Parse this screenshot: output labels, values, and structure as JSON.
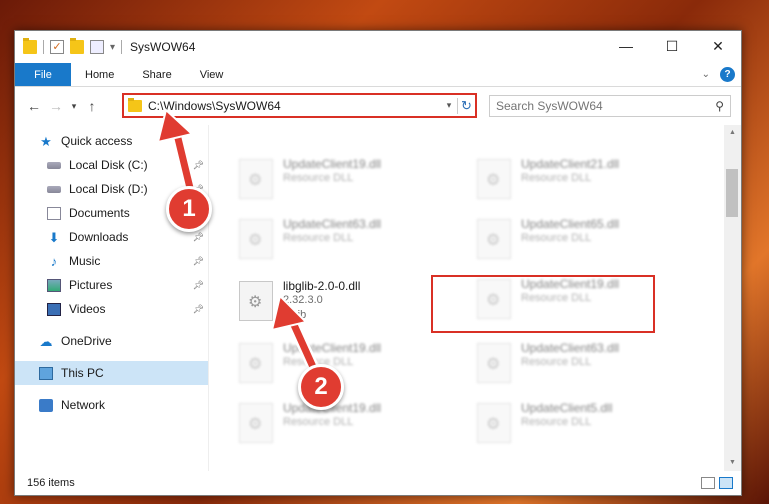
{
  "window": {
    "title": "SysWOW64",
    "controls": {
      "minimize": "—",
      "maximize": "☐",
      "close": "✕"
    }
  },
  "ribbon": {
    "tabs": [
      "File",
      "Home",
      "Share",
      "View"
    ]
  },
  "address": {
    "path": "C:\\Windows\\SysWOW64",
    "search_placeholder": "Search SysWOW64"
  },
  "sidebar": {
    "items": [
      {
        "label": "Quick access",
        "icon": "star-icon"
      },
      {
        "label": "Local Disk (C:)",
        "icon": "disk-icon",
        "pinned": true
      },
      {
        "label": "Local Disk (D:)",
        "icon": "disk-icon",
        "pinned": true
      },
      {
        "label": "Documents",
        "icon": "documents-icon",
        "pinned": true
      },
      {
        "label": "Downloads",
        "icon": "download-icon",
        "pinned": true
      },
      {
        "label": "Music",
        "icon": "music-icon",
        "pinned": true
      },
      {
        "label": "Pictures",
        "icon": "pictures-icon",
        "pinned": true
      },
      {
        "label": "Videos",
        "icon": "videos-icon",
        "pinned": true
      },
      {
        "label": "OneDrive",
        "icon": "cloud-icon"
      },
      {
        "label": "This PC",
        "icon": "pc-icon",
        "selected": true
      },
      {
        "label": "Network",
        "icon": "network-icon"
      }
    ]
  },
  "files": [
    {
      "name": "UpdateClient19.dll",
      "line1": "Resource DLL",
      "line2": ""
    },
    {
      "name": "UpdateClient21.dll",
      "line1": "Resource DLL",
      "line2": ""
    },
    {
      "name": "UpdateClient63.dll",
      "line1": "Resource DLL",
      "line2": ""
    },
    {
      "name": "UpdateClient65.dll",
      "line1": "Resource DLL",
      "line2": ""
    },
    {
      "name": "libglib-2.0-0.dll",
      "line1": "2.32.3.0",
      "line2": "GLib"
    },
    {
      "name": "UpdateClient19.dll",
      "line1": "Resource DLL",
      "line2": ""
    },
    {
      "name": "UpdateClient19.dll",
      "line1": "Resource DLL",
      "line2": ""
    },
    {
      "name": "UpdateClient63.dll",
      "line1": "Resource DLL",
      "line2": ""
    },
    {
      "name": "UpdateClient19.dll",
      "line1": "Resource DLL",
      "line2": ""
    },
    {
      "name": "UpdateClient5.dll",
      "line1": "Resource DLL",
      "line2": ""
    }
  ],
  "status": {
    "count": "156 items"
  },
  "annotations": {
    "step1": "1",
    "step2": "2",
    "color": "#e03c31"
  }
}
